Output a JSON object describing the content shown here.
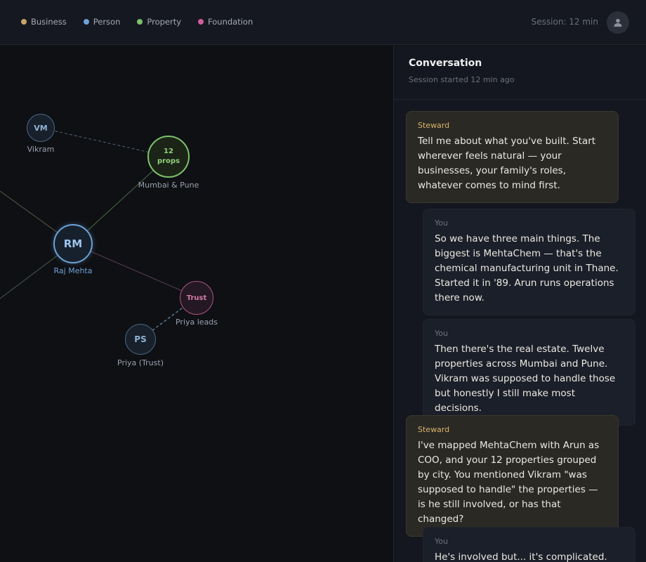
{
  "legend": [
    {
      "label": "Business",
      "color": "#c9a46a"
    },
    {
      "label": "Person",
      "color": "#6ea2d6"
    },
    {
      "label": "Property",
      "color": "#7dc16a"
    },
    {
      "label": "Foundation",
      "color": "#cf5f9c"
    }
  ],
  "header": {
    "session": "Session: 12 min",
    "avatar_icon": "user-icon"
  },
  "graph": {
    "nodes": {
      "vikram": {
        "initials": "VM",
        "label": "Vikram"
      },
      "props": {
        "line1": "12",
        "line2": "props",
        "label": "Mumbai & Pune"
      },
      "raj": {
        "initials": "RM",
        "label": "Raj Mehta"
      },
      "trust": {
        "initials": "Trust",
        "label": "Priya leads"
      },
      "priya": {
        "initials": "PS",
        "label": "Priya (Trust)"
      }
    }
  },
  "conversation": {
    "title": "Conversation",
    "subtitle": "Session started 12 min ago",
    "messages": [
      {
        "who": "Steward",
        "text": "Tell me about what you've built. Start wherever feels natural — your businesses, your family's roles, whatever comes to mind first."
      },
      {
        "who": "You",
        "text": "So we have three main things. The biggest is MehtaChem — that's the chemical manufacturing unit in Thane. Started it in '89. Arun runs operations there now."
      },
      {
        "who": "You",
        "text": "Then there's the real estate. Twelve properties across Mumbai and Pune. Vikram was supposed to handle those but honestly I still make most decisions."
      },
      {
        "who": "Steward",
        "text": "I've mapped MehtaChem with Arun as COO, and your 12 properties grouped by city. You mentioned Vikram \"was supposed to handle\" the properties — is he still involved, or has that changed?"
      },
      {
        "who": "You",
        "text": "He's involved but... it's complicated. He's"
      }
    ]
  }
}
